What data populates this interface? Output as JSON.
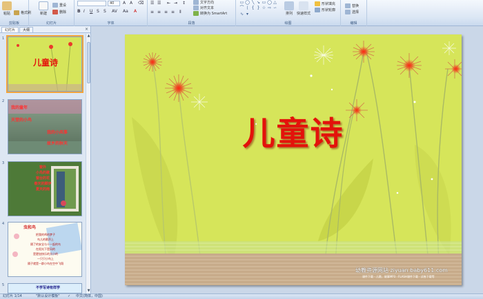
{
  "ribbon": {
    "clipboard": {
      "paste_label": "粘贴",
      "copy_format_label": "格式刷",
      "group_label": "剪贴板"
    },
    "slides": {
      "new_slide_label": "新建\n幻灯片",
      "reset_label": "重设",
      "delete_label": "删除",
      "group_label": "幻灯片"
    },
    "font": {
      "font_size": "40",
      "group_label": "字体"
    },
    "paragraph": {
      "align_text_label": "对齐文本",
      "smartart_label": "转换为 SmartArt",
      "group_label": "段落"
    },
    "drawing": {
      "arrange_label": "排列",
      "quick_styles_label": "快速样式",
      "shape_fill_label": "形状填充",
      "shape_outline_label": "形状轮廓",
      "group_label": "绘图"
    },
    "editing": {
      "replace_label": "替换",
      "select_label": "选择",
      "group_label": "编辑"
    }
  },
  "panel": {
    "tabs": [
      "幻灯片",
      "大纲"
    ],
    "close_symbol": "×",
    "slides": [
      {
        "number": "1",
        "title": "儿童诗"
      },
      {
        "number": "2",
        "lines": [
          "我的童年",
          "天堂的小鸟",
          "我的小风筝",
          "故乡的秋天"
        ]
      },
      {
        "number": "3",
        "lines": [
          "窗外",
          "小鸟的歌",
          "窗台的花",
          "春天的脚步",
          "夏天的雨"
        ]
      },
      {
        "number": "4",
        "heading": "虫和鸟",
        "lines": [
          "把我的鸡的梦子",
          "鸟儿的歌声上",
          "隔了的安全与十一起的鸟",
          "在阳光下是风的",
          "是更加快乐的大小的",
          "一只只小鸟上",
          "隔子就是一群小鸟在空中飞翔"
        ]
      },
      {
        "number": "5",
        "heading": "不学写诗有样学"
      }
    ]
  },
  "slide": {
    "title": "儿童诗",
    "watermark_main": "幼教资源网站 ziyuan.baby611.com",
    "watermark_sub": "课件下载 · 儿歌、故事MP3 · FLASH课件下载 · 试卷下载等"
  },
  "status": {
    "slide_info": "幻灯片 1/14",
    "theme": "\"默认设计模板\"",
    "language": "中文(简体，中国)"
  },
  "colors": {
    "slide_bg": "#d6e55a",
    "title_red": "#e3120b",
    "ribbon_bg": "#dbe6f4",
    "selection": "#f2a53c"
  }
}
